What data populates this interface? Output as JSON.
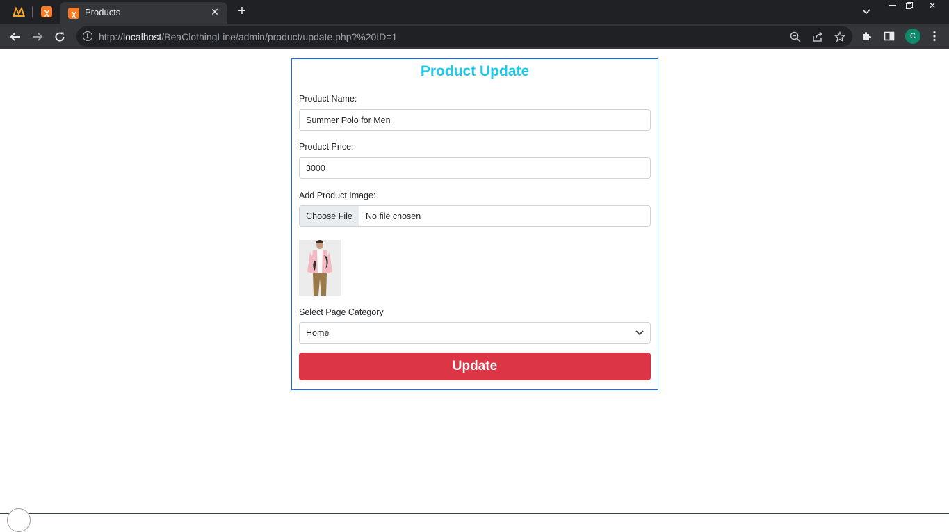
{
  "browser": {
    "tab_title": "Products",
    "url_prefix": "http://",
    "url_host": "localhost",
    "url_path": "/BeaClothingLine/admin/product/update.php?%20ID=1",
    "profile_initial": "C"
  },
  "form": {
    "title": "Product Update",
    "name_label": "Product Name:",
    "name_value": "Summer Polo for Men",
    "price_label": "Product Price:",
    "price_value": "3000",
    "image_label": "Add Product Image:",
    "choose_file_label": "Choose File",
    "file_status": "No file chosen",
    "category_label": "Select Page Category",
    "category_value": "Home",
    "submit_label": "Update"
  },
  "colors": {
    "title": "#1ec8e8",
    "card_border": "#0d6efd",
    "submit_bg": "#dc3545",
    "chrome_dark": "#202124",
    "chrome_toolbar": "#35363a"
  },
  "icons": [
    "xampp-icon",
    "close-icon",
    "plus-icon",
    "back-arrow-icon",
    "forward-arrow-icon",
    "reload-icon",
    "info-icon",
    "zoom-icon",
    "share-icon",
    "star-icon",
    "puzzle-icon",
    "sidepanel-icon",
    "kebab-menu-icon",
    "chevron-down-icon"
  ]
}
